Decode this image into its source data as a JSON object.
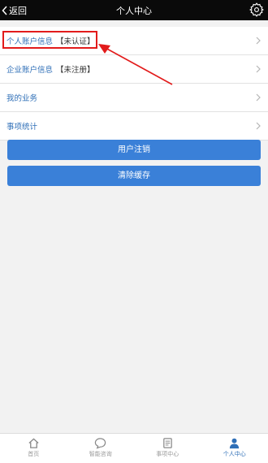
{
  "header": {
    "back_label": "返回",
    "title": "个人中心",
    "settings_icon": "gear-icon"
  },
  "menu": {
    "items": [
      {
        "label": "个人账户信息",
        "status": "【未认证】"
      },
      {
        "label": "企业账户信息",
        "status": "【未注册】"
      },
      {
        "label": "我的业务",
        "status": ""
      },
      {
        "label": "事项统计",
        "status": ""
      }
    ]
  },
  "buttons": {
    "logout": "用户注销",
    "clear_cache": "清除缓存"
  },
  "tabbar": {
    "items": [
      {
        "label": "首页",
        "icon": "home-icon"
      },
      {
        "label": "智能咨询",
        "icon": "chat-icon"
      },
      {
        "label": "事项中心",
        "icon": "list-icon"
      },
      {
        "label": "个人中心",
        "icon": "user-icon"
      }
    ],
    "active_index": 3
  },
  "colors": {
    "accent": "#3a80d8",
    "highlight": "#e21b1b",
    "header_bg": "#0a0a0a"
  }
}
